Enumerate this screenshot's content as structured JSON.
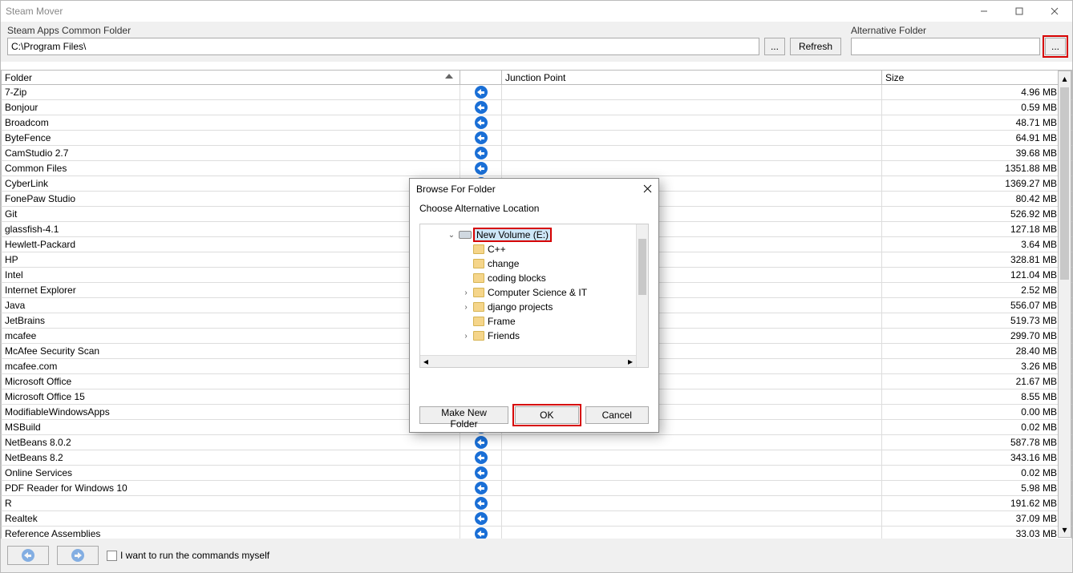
{
  "window": {
    "title": "Steam Mover"
  },
  "toolbar": {
    "source_label": "Steam Apps Common Folder",
    "source_path": "C:\\Program Files\\",
    "browse_label": "...",
    "refresh_label": "Refresh",
    "alt_label": "Alternative Folder",
    "alt_path": ""
  },
  "columns": {
    "folder": "Folder",
    "arrow": "",
    "junction": "Junction Point",
    "size": "Size"
  },
  "rows": [
    {
      "folder": "7-Zip",
      "size": "4.96 MB"
    },
    {
      "folder": "Bonjour",
      "size": "0.59 MB"
    },
    {
      "folder": "Broadcom",
      "size": "48.71 MB"
    },
    {
      "folder": "ByteFence",
      "size": "64.91 MB"
    },
    {
      "folder": "CamStudio 2.7",
      "size": "39.68 MB"
    },
    {
      "folder": "Common Files",
      "size": "1351.88 MB"
    },
    {
      "folder": "CyberLink",
      "size": "1369.27 MB"
    },
    {
      "folder": "FonePaw Studio",
      "size": "80.42 MB"
    },
    {
      "folder": "Git",
      "size": "526.92 MB"
    },
    {
      "folder": "glassfish-4.1",
      "size": "127.18 MB"
    },
    {
      "folder": "Hewlett-Packard",
      "size": "3.64 MB"
    },
    {
      "folder": "HP",
      "size": "328.81 MB"
    },
    {
      "folder": "Intel",
      "size": "121.04 MB"
    },
    {
      "folder": "Internet Explorer",
      "size": "2.52 MB"
    },
    {
      "folder": "Java",
      "size": "556.07 MB"
    },
    {
      "folder": "JetBrains",
      "size": "519.73 MB"
    },
    {
      "folder": "mcafee",
      "size": "299.70 MB"
    },
    {
      "folder": "McAfee Security Scan",
      "size": "28.40 MB"
    },
    {
      "folder": "mcafee.com",
      "size": "3.26 MB"
    },
    {
      "folder": "Microsoft Office",
      "size": "21.67 MB"
    },
    {
      "folder": "Microsoft Office 15",
      "size": "8.55 MB"
    },
    {
      "folder": "ModifiableWindowsApps",
      "size": "0.00 MB"
    },
    {
      "folder": "MSBuild",
      "size": "0.02 MB"
    },
    {
      "folder": "NetBeans 8.0.2",
      "size": "587.78 MB"
    },
    {
      "folder": "NetBeans 8.2",
      "size": "343.16 MB"
    },
    {
      "folder": "Online Services",
      "size": "0.02 MB"
    },
    {
      "folder": "PDF Reader for Windows 10",
      "size": "5.98 MB"
    },
    {
      "folder": "R",
      "size": "191.62 MB"
    },
    {
      "folder": "Realtek",
      "size": "37.09 MB"
    },
    {
      "folder": "Reference Assemblies",
      "size": "33.03 MB"
    }
  ],
  "footer": {
    "checkbox_label": "I want to run the commands myself"
  },
  "dialog": {
    "title": "Browse For Folder",
    "prompt": "Choose Alternative Location",
    "selected": "New Volume (E:)",
    "children": [
      {
        "name": "C++",
        "expandable": false
      },
      {
        "name": "change",
        "expandable": false
      },
      {
        "name": "coding blocks",
        "expandable": false
      },
      {
        "name": "Computer Science & IT",
        "expandable": true
      },
      {
        "name": "django projects",
        "expandable": true
      },
      {
        "name": "Frame",
        "expandable": false
      },
      {
        "name": "Friends",
        "expandable": true
      }
    ],
    "make_new": "Make New Folder",
    "ok": "OK",
    "cancel": "Cancel"
  }
}
